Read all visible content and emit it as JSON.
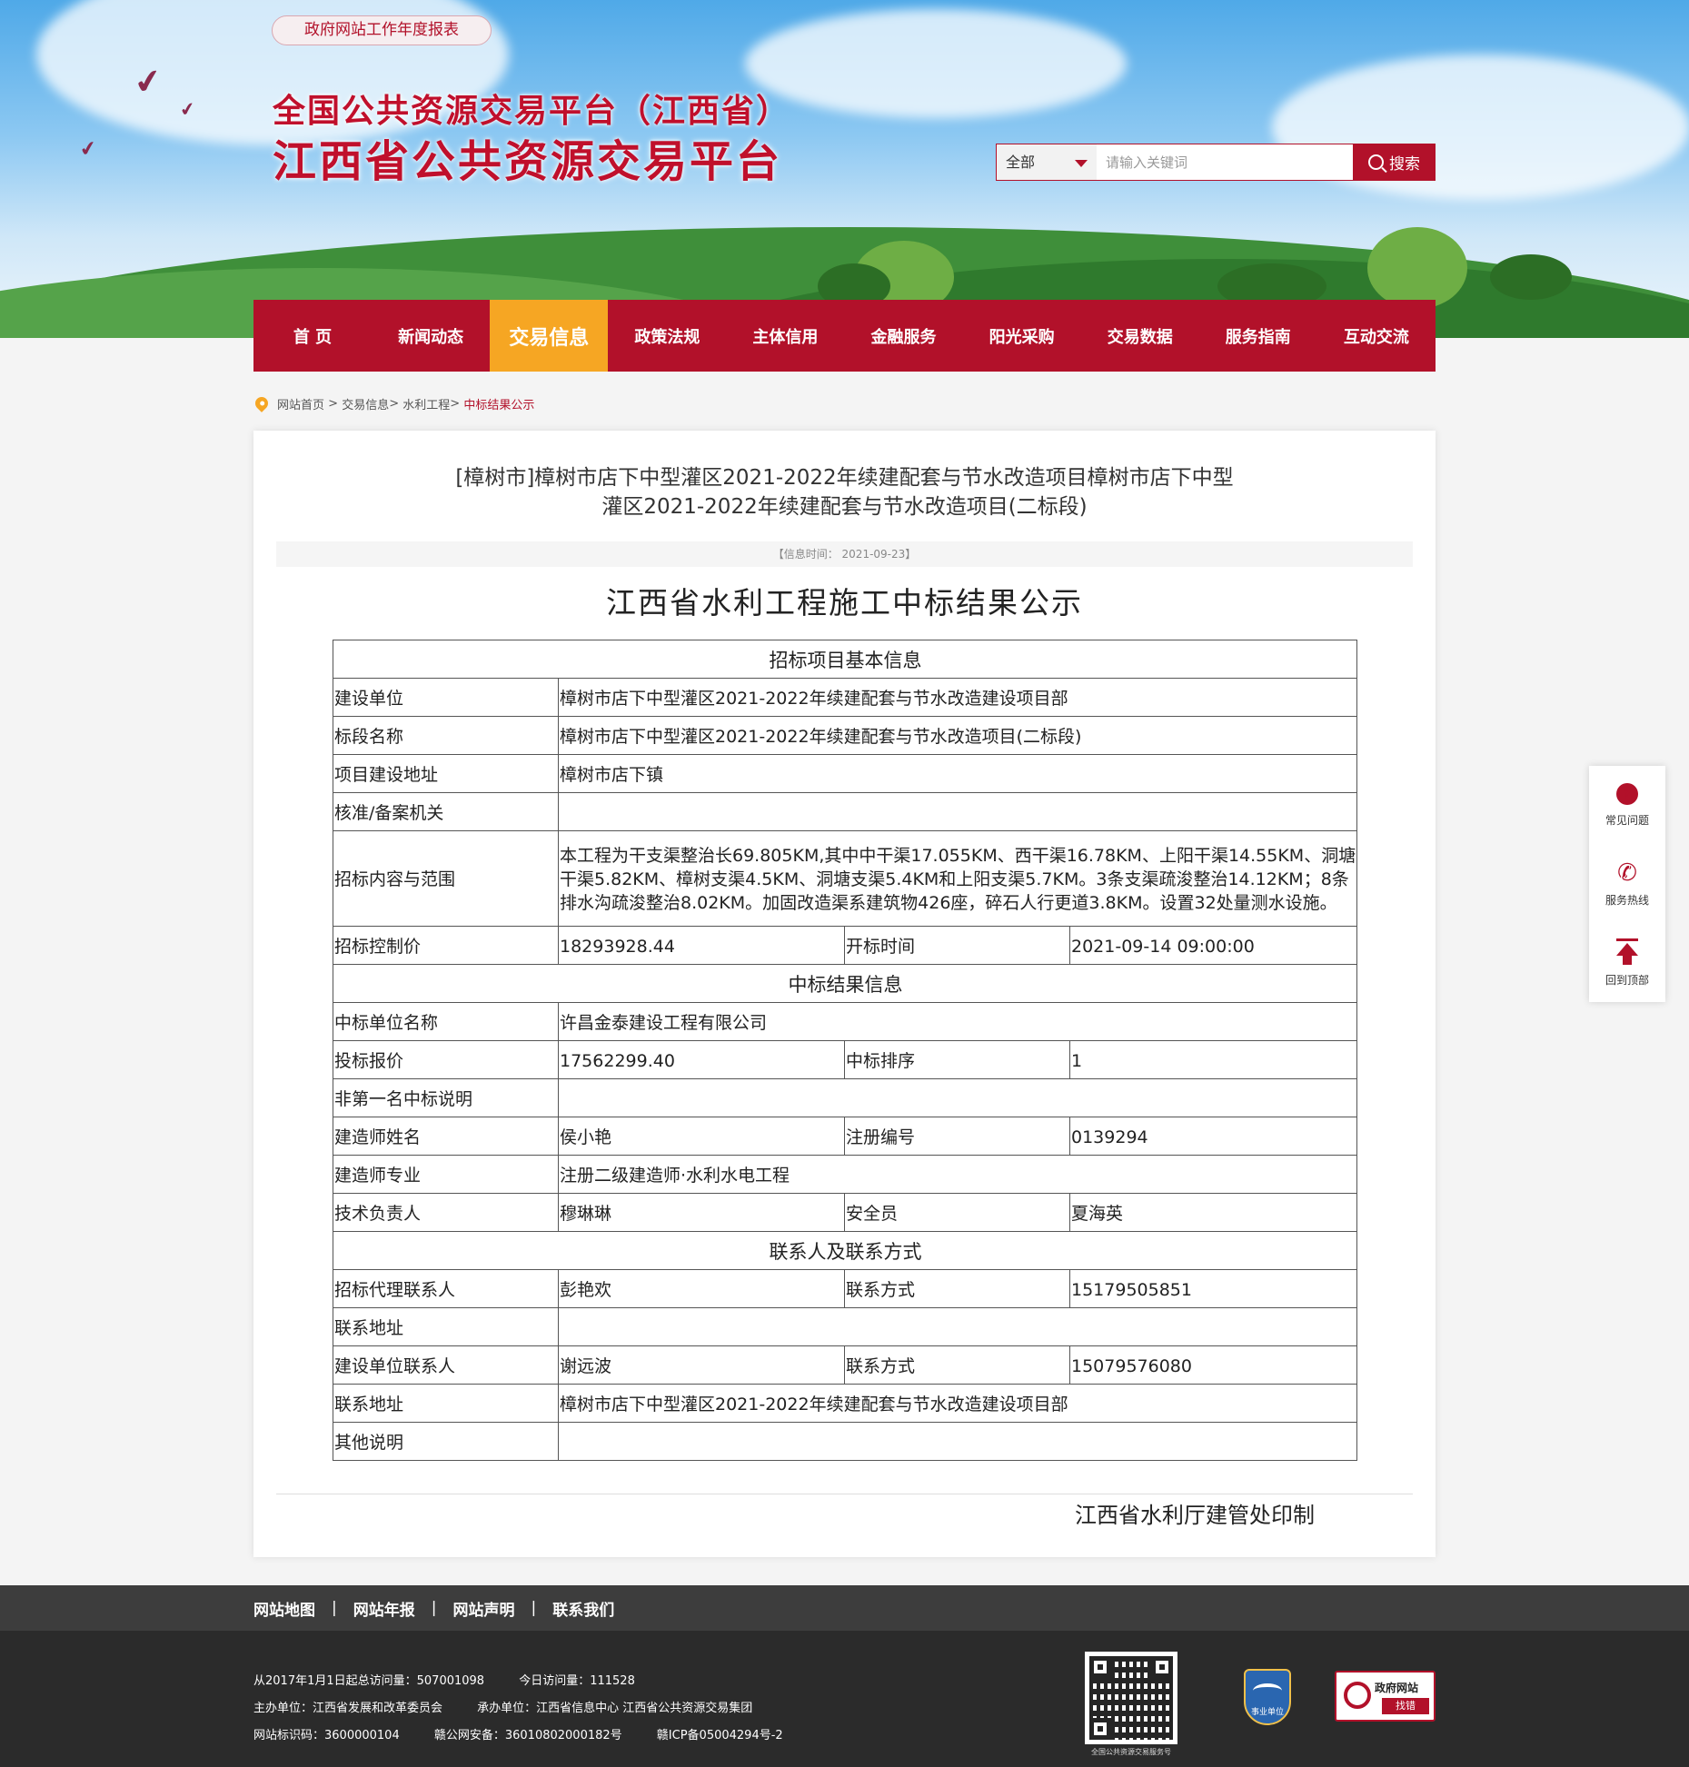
{
  "header": {
    "report_button": "政府网站工作年度报表",
    "title_line1": "全国公共资源交易平台（江西省）",
    "title_line2": "江西省公共资源交易平台",
    "search": {
      "scope": "全部",
      "placeholder": "请输入关键词",
      "button": "搜索"
    }
  },
  "nav": {
    "items": [
      "首 页",
      "新闻动态",
      "交易信息",
      "政策法规",
      "主体信用",
      "金融服务",
      "阳光采购",
      "交易数据",
      "服务指南",
      "互动交流"
    ],
    "active_index": 2
  },
  "breadcrumb": {
    "items": [
      "网站首页",
      "交易信息",
      "水利工程"
    ],
    "separator": ">",
    "current": "中标结果公示"
  },
  "article": {
    "title_line1": "[樟树市]樟树市店下中型灌区2021-2022年续建配套与节水改造项目樟树市店下中型",
    "title_line2": "灌区2021-2022年续建配套与节水改造项目(二标段)",
    "info_time": "【信息时间： 2021-09-23】",
    "notice_heading": "江西省水利工程施工中标结果公示",
    "print_note": "江西省水利厅建管处印制"
  },
  "table": {
    "sec_basic": "招标项目基本信息",
    "build_unit_label": "建设单位",
    "build_unit": "樟树市店下中型灌区2021-2022年续建配套与节水改造建设项目部",
    "section_name_label": "标段名称",
    "section_name": "樟树市店下中型灌区2021-2022年续建配套与节水改造项目(二标段)",
    "location_label": "项目建设地址",
    "location": "樟树市店下镇",
    "approval_label": "核准/备案机关",
    "approval": "",
    "scope_label": "招标内容与范围",
    "scope": "本工程为干支渠整治长69.805KM,其中中干渠17.055KM、西干渠16.78KM、上阳干渠14.55KM、洞塘干渠5.82KM、樟树支渠4.5KM、洞塘支渠5.4KM和上阳支渠5.7KM。3条支渠疏浚整治14.12KM；8条排水沟疏浚整治8.02KM。加固改造渠系建筑物426座，碎石人行更道3.8KM。设置32处量测水设施。",
    "control_price_label": "招标控制价",
    "control_price": "18293928.44",
    "open_time_label": "开标时间",
    "open_time": "2021-09-14 09:00:00",
    "sec_result": "中标结果信息",
    "winner_label": "中标单位名称",
    "winner": "许昌金泰建设工程有限公司",
    "bid_price_label": "投标报价",
    "bid_price": "17562299.40",
    "rank_label": "中标排序",
    "rank": "1",
    "non_first_label": "非第一名中标说明",
    "non_first": "",
    "builder_name_label": "建造师姓名",
    "builder_name": "侯小艳",
    "reg_no_label": "注册编号",
    "reg_no": "0139294",
    "builder_major_label": "建造师专业",
    "builder_major": "注册二级建造师·水利水电工程",
    "tech_lead_label": "技术负责人",
    "tech_lead": "穆琳琳",
    "safety_label": "安全员",
    "safety": "夏海英",
    "sec_contact": "联系人及联系方式",
    "agent_contact_label": "招标代理联系人",
    "agent_contact": "彭艳欢",
    "agent_phone_label": "联系方式",
    "agent_phone": "15179505851",
    "agent_addr_label": "联系地址",
    "agent_addr": "",
    "owner_contact_label": "建设单位联系人",
    "owner_contact": "谢远波",
    "owner_phone_label": "联系方式",
    "owner_phone": "15079576080",
    "owner_addr_label": "联系地址",
    "owner_addr": "樟树市店下中型灌区2021-2022年续建配套与节水改造建设项目部",
    "other_label": "其他说明",
    "other": ""
  },
  "float_bar": {
    "faq": "常见问题",
    "hotline": "服务热线",
    "top": "回到顶部"
  },
  "footer": {
    "links": [
      "网站地图",
      "网站年报",
      "网站声明",
      "联系我们"
    ],
    "link_sep": "|",
    "total_visits": "从2017年1月1日起总访问量：507001098",
    "today_visits": "今日访问量：111528",
    "sponsor": "主办单位：江西省发展和改革委员会",
    "organizer": "承办单位：江西省信息中心 江西省公共资源交易集团",
    "site_id": "网站标识码：3600000104",
    "police_record": "赣公网安备：36010802000182号",
    "icp": "赣ICP备05004294号-2",
    "qr_caption": "全国公共资源交易服务号",
    "badge_text": "事业单位",
    "gov_err_title": "政府网站",
    "gov_err_action": "找错"
  },
  "colors": {
    "brand_red": "#b2112a",
    "active_orange": "#f6a623"
  }
}
